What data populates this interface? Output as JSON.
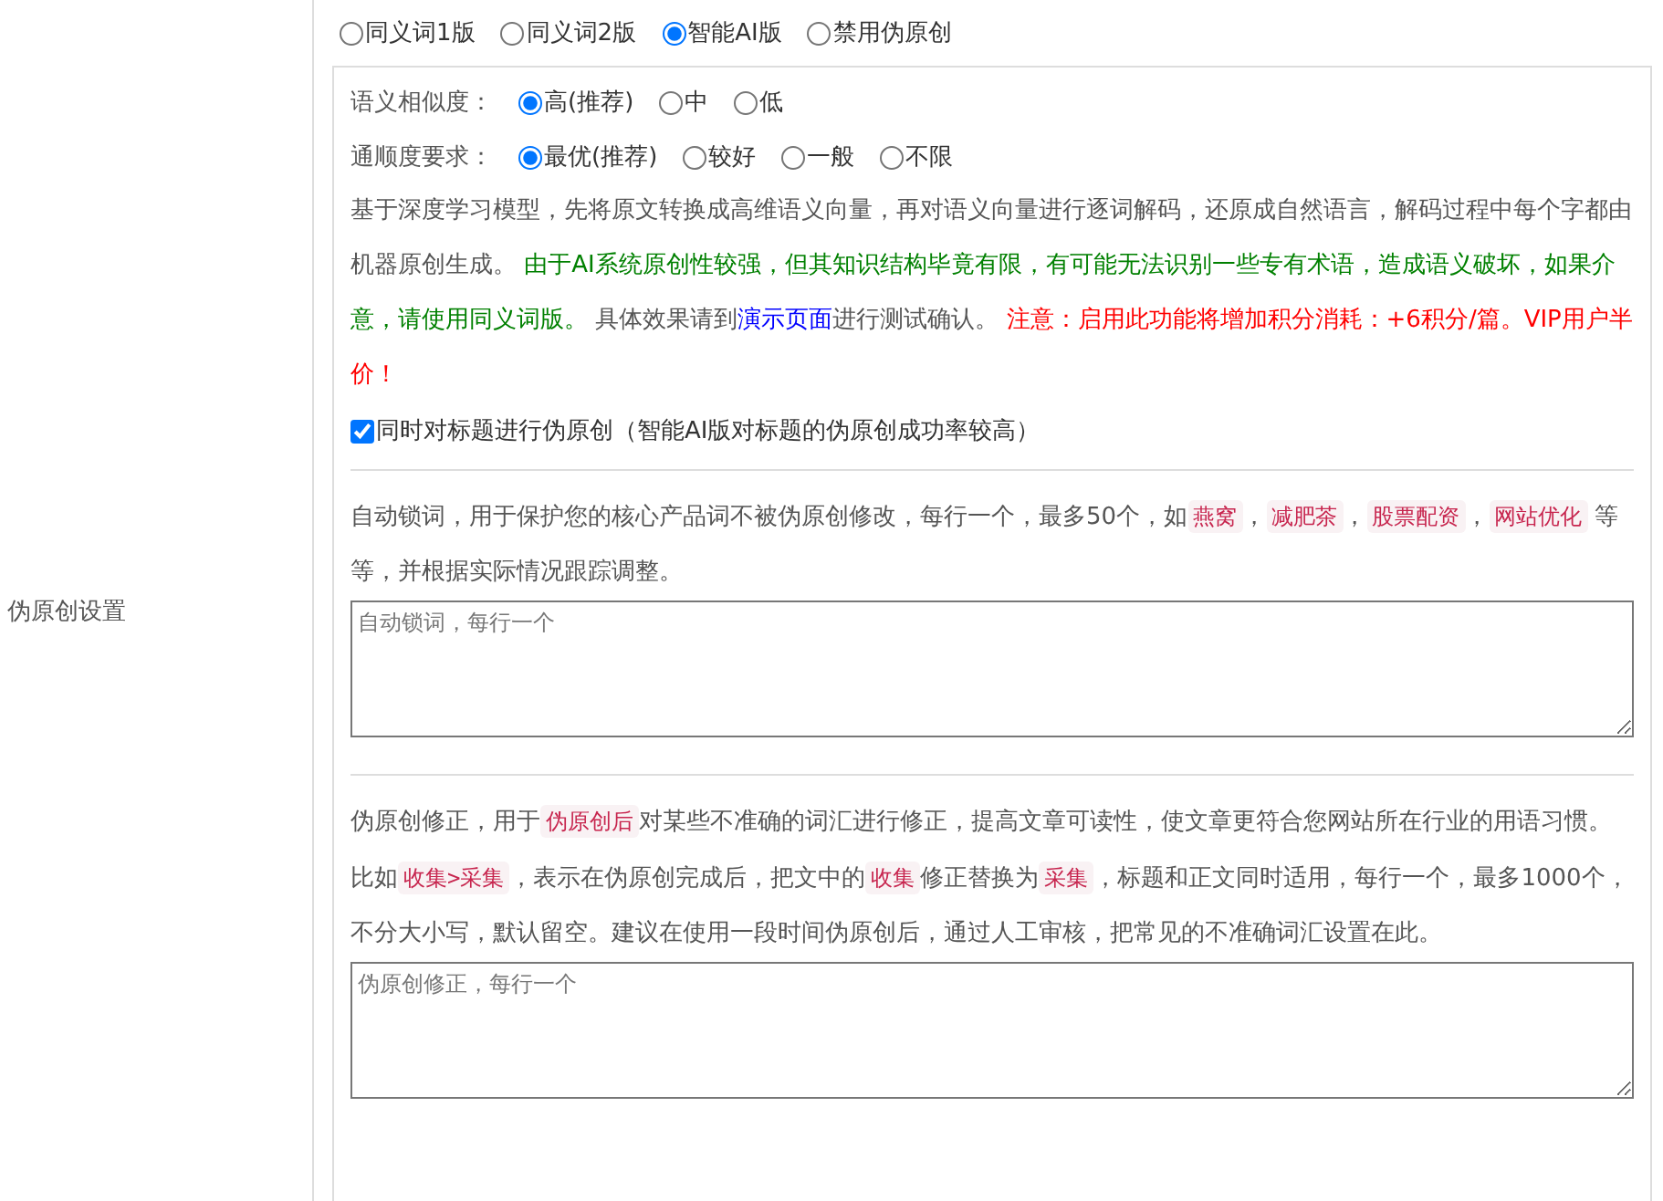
{
  "section_label": "伪原创设置",
  "engine_options": [
    {
      "label": "同义词1版",
      "selected": false
    },
    {
      "label": "同义词2版",
      "selected": false
    },
    {
      "label": "智能AI版",
      "selected": true
    },
    {
      "label": "禁用伪原创",
      "selected": false
    }
  ],
  "similarity": {
    "label": "语义相似度：",
    "options": [
      {
        "label": "高(推荐)",
        "selected": true
      },
      {
        "label": "中",
        "selected": false
      },
      {
        "label": "低",
        "selected": false
      }
    ]
  },
  "fluency": {
    "label": "通顺度要求：",
    "options": [
      {
        "label": "最优(推荐)",
        "selected": true
      },
      {
        "label": "较好",
        "selected": false
      },
      {
        "label": "一般",
        "selected": false
      },
      {
        "label": "不限",
        "selected": false
      }
    ]
  },
  "ai_note": [
    {
      "kind": "plain",
      "text": "基于深度学习模型，先将原文转换成高维语义向量，再对语义向量进行逐词解码，还原成自然语言，解码过程中每个字都由机器原创生成。 "
    },
    {
      "kind": "green",
      "text": "由于AI系统原创性较强，但其知识结构毕竟有限，有可能无法识别一些专有术语，造成语义破坏，如果介意，请使用同义词版。"
    },
    {
      "kind": "plain",
      "text": " 具体效果请到"
    },
    {
      "kind": "link",
      "text": "演示页面"
    },
    {
      "kind": "plain",
      "text": "进行测试确认。 "
    },
    {
      "kind": "red",
      "text": "注意：启用此功能将增加积分消耗：+6积分/篇。VIP用户半价！"
    }
  ],
  "title_checkbox": {
    "label": "同时对标题进行伪原创（智能AI版对标题的伪原创成功率较高）",
    "checked": true
  },
  "lock_words": {
    "description": [
      {
        "kind": "plain",
        "text": "自动锁词，用于保护您的核心产品词不被伪原创修改，每行一个，最多50个，如"
      },
      {
        "kind": "code",
        "text": "燕窝"
      },
      {
        "kind": "plain",
        "text": "，"
      },
      {
        "kind": "code",
        "text": "减肥茶"
      },
      {
        "kind": "plain",
        "text": "，"
      },
      {
        "kind": "code",
        "text": "股票配资"
      },
      {
        "kind": "plain",
        "text": "，"
      },
      {
        "kind": "code",
        "text": "网站优化"
      },
      {
        "kind": "plain",
        "text": " 等等，并根据实际情况跟踪调整。"
      }
    ],
    "placeholder": "自动锁词，每行一个"
  },
  "correction": {
    "description": [
      {
        "kind": "plain",
        "text": "伪原创修正，用于"
      },
      {
        "kind": "code",
        "text": "伪原创后"
      },
      {
        "kind": "plain",
        "text": "对某些不准确的词汇进行修正，提高文章可读性，使文章更符合您网站所在行业的用语习惯。比如"
      },
      {
        "kind": "code",
        "text": "收集>采集"
      },
      {
        "kind": "plain",
        "text": "，表示在伪原创完成后，把文中的"
      },
      {
        "kind": "code",
        "text": "收集"
      },
      {
        "kind": "plain",
        "text": "修正替换为"
      },
      {
        "kind": "code",
        "text": "采集"
      },
      {
        "kind": "plain",
        "text": "，标题和正文同时适用，每行一个，最多1000个，不分大小写，默认留空。建议在使用一段时间伪原创后，通过人工审核，把常见的不准确词汇设置在此。"
      }
    ],
    "placeholder": "伪原创修正，每行一个"
  }
}
